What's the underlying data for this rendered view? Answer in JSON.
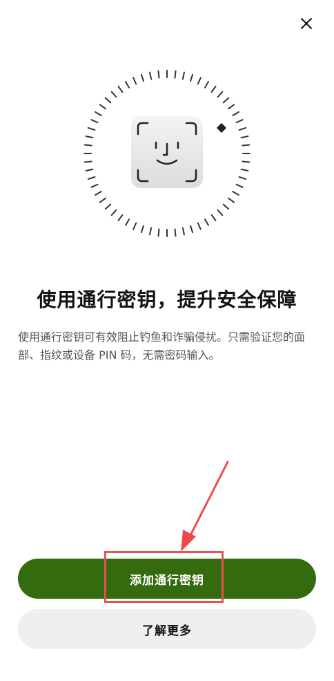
{
  "header": {
    "close_icon": "close-icon"
  },
  "illustration": {
    "icon": "face-id-icon",
    "ring_icon": "scan-ring-icon",
    "marker_icon": "diamond-marker-icon"
  },
  "content": {
    "title": "使用通行密钥，提升安全保障",
    "description": "使用通行密钥可有效阻止钓鱼和诈骗侵扰。只需验证您的面部、指纹或设备 PIN 码，无需密码输入。"
  },
  "actions": {
    "primary_label": "添加通行密钥",
    "secondary_label": "了解更多"
  },
  "annotation": {
    "arrow_icon": "pointer-arrow-icon",
    "highlight_color": "#e6524f"
  },
  "colors": {
    "primary": "#346b0e",
    "secondary_bg": "#efefef",
    "text": "#111111",
    "muted_text": "#555555"
  }
}
